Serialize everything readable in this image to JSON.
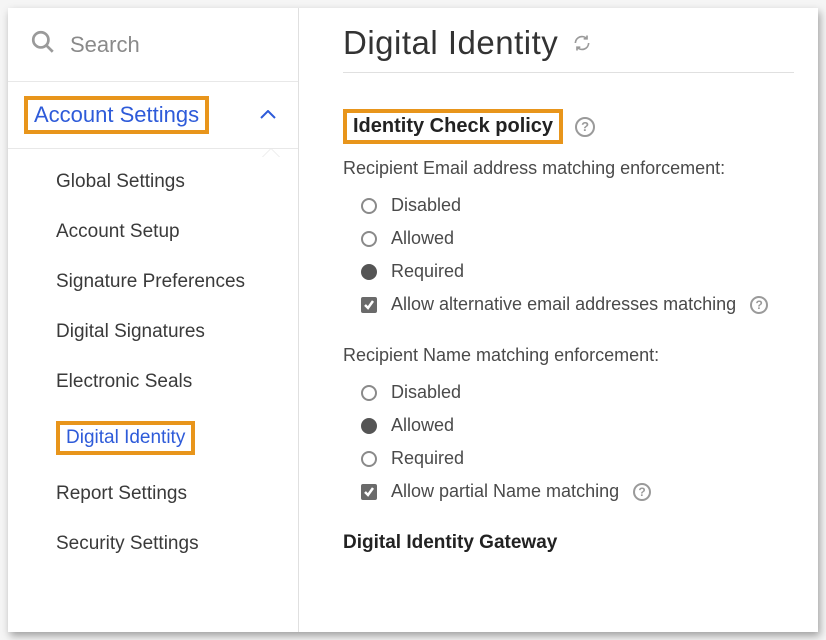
{
  "search": {
    "placeholder": "Search"
  },
  "sidebar": {
    "section_label": "Account Settings",
    "items": [
      {
        "label": "Global Settings"
      },
      {
        "label": "Account Setup"
      },
      {
        "label": "Signature Preferences"
      },
      {
        "label": "Digital Signatures"
      },
      {
        "label": "Electronic Seals"
      },
      {
        "label": "Digital Identity"
      },
      {
        "label": "Report Settings"
      },
      {
        "label": "Security Settings"
      }
    ]
  },
  "main": {
    "title": "Digital Identity",
    "policy_title": "Identity Check policy",
    "email_group": {
      "label": "Recipient Email address matching enforcement:",
      "options": [
        "Disabled",
        "Allowed",
        "Required"
      ],
      "selected": "Required",
      "checkbox_label": "Allow alternative email addresses matching",
      "checkbox_checked": true
    },
    "name_group": {
      "label": "Recipient Name matching enforcement:",
      "options": [
        "Disabled",
        "Allowed",
        "Required"
      ],
      "selected": "Allowed",
      "checkbox_label": "Allow partial Name matching",
      "checkbox_checked": true
    },
    "gateway_heading": "Digital Identity Gateway"
  }
}
